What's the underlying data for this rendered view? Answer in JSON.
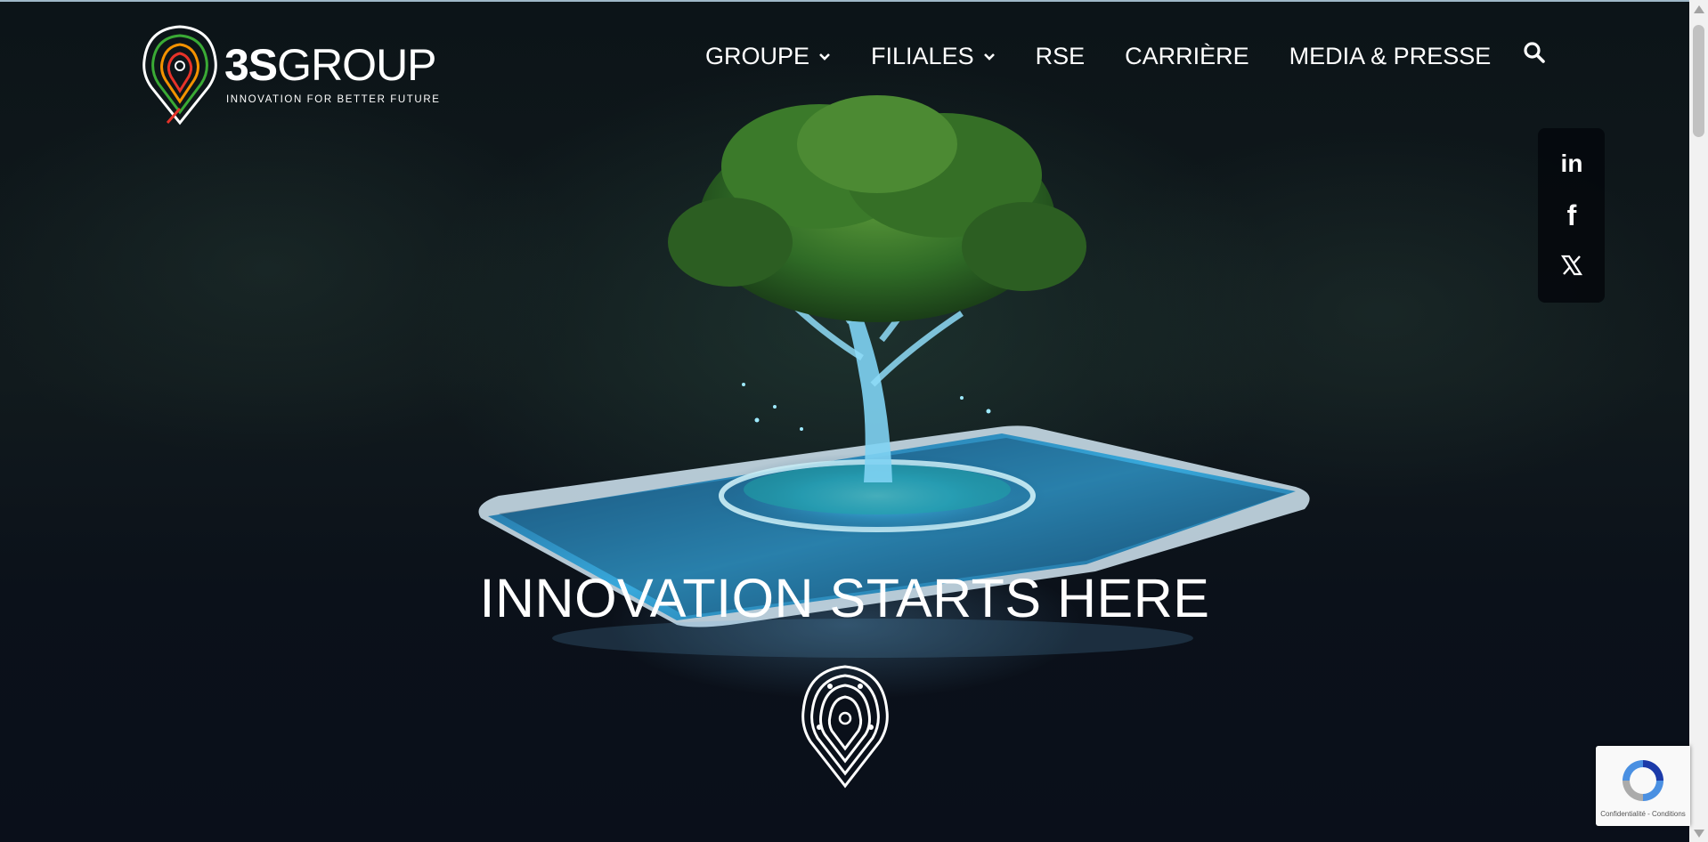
{
  "brand": {
    "name_bold": "3S",
    "name_light": "GROUP",
    "tagline": "INNOVATION FOR BETTER FUTURE"
  },
  "nav": {
    "items": [
      {
        "label": "GROUPE",
        "has_dropdown": true
      },
      {
        "label": "FILIALES",
        "has_dropdown": true
      },
      {
        "label": "RSE",
        "has_dropdown": false
      },
      {
        "label": "CARRIÈRE",
        "has_dropdown": false
      },
      {
        "label": "MEDIA & PRESSE",
        "has_dropdown": false
      }
    ]
  },
  "icons": {
    "search": "search-icon",
    "linkedin": "linkedin-icon",
    "facebook": "facebook-icon",
    "x": "x-icon",
    "linkedin_glyph": "in",
    "facebook_glyph": "f"
  },
  "hero": {
    "headline": "INNOVATION STARTS HERE"
  },
  "recaptcha": {
    "text": "Confidentialité - Conditions"
  },
  "colors": {
    "background": "#0a1019",
    "text": "#ffffff",
    "social_bg": "#05080c",
    "logo_red": "#e63329",
    "logo_orange": "#f39200",
    "logo_green": "#3aaa35",
    "recaptcha_blue": "#4a90e2"
  }
}
